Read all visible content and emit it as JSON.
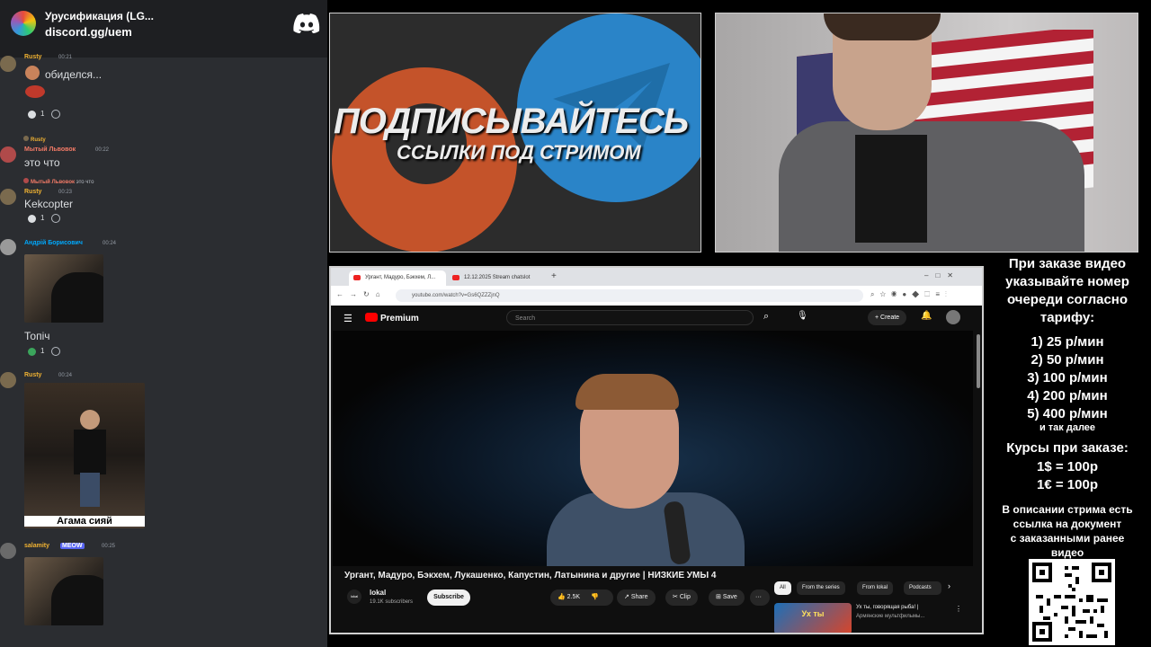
{
  "discord": {
    "server_title": "Урусификация (LG...",
    "invite": "discord.gg/uem",
    "messages": [
      {
        "author": "Rusty",
        "author_color": "#f0b232",
        "timestamp": "00:21",
        "text": "обиделся...",
        "reaction_count": "1"
      },
      {
        "reply_author": "Rusty",
        "author": "Мытый Львовок",
        "author_color": "#f47b67",
        "timestamp": "00:22",
        "text": "это что"
      },
      {
        "reply_author": "Мытый Львовок",
        "reply_text": "это что",
        "author": "Rusty",
        "author_color": "#f0b232",
        "timestamp": "00:23",
        "text": "Kekcopter",
        "reaction_count": "1"
      },
      {
        "author": "Андрій Борисович",
        "author_color": "#00a8fc",
        "timestamp": "00:24",
        "text": "Топіч",
        "reaction_count": "1"
      },
      {
        "author": "Rusty",
        "author_color": "#f0b232",
        "timestamp": "00:24",
        "gif_caption": "Агама сияй"
      },
      {
        "author": "salamity",
        "author_color": "#f0b232",
        "badge": "MEOW",
        "timestamp": "00:25"
      }
    ]
  },
  "banner": {
    "title": "ПОДПИСЫВАЙТЕСЬ",
    "subtitle": "ССЫЛКИ ПОД СТРИМОМ"
  },
  "browser": {
    "tabs": [
      {
        "label": "Ургант, Мадуро, Бэкхем, Л...",
        "active": true
      },
      {
        "label": "12.12.2025 Stream chatslot",
        "active": false
      }
    ],
    "url": "youtube.com/watch?v=Gs6QZZZjnQ"
  },
  "youtube": {
    "logo": "Premium",
    "search_placeholder": "Search",
    "create_label": "Create",
    "video_title": "Ургант, Мадуро, Бэкхем, Лукашенко, Капустин, Латынина и другие | НИЗКИЕ УМЫ 4",
    "channel": {
      "name": "lokal",
      "subscribers": "19.1K subscribers",
      "avatar_text": "lokal"
    },
    "subscribe_label": "Subscribe",
    "likes": "2.5K",
    "share_label": "Share",
    "clip_label": "Clip",
    "save_label": "Save",
    "chips": [
      "All",
      "From the series",
      "From lokal",
      "Podcasts"
    ],
    "recommendation": {
      "thumb_text": "Ух ты",
      "title": "Ух ты, говорящая рыба! |",
      "subtitle": "Армянские мультфильмы..."
    }
  },
  "order_info": {
    "heading_lines": [
      "При заказе видео",
      "указывайте номер",
      "очереди согласно",
      "тарифу:"
    ],
    "tariffs": [
      "1) 25 р/мин",
      "2) 50 р/мин",
      "3) 100 р/мин",
      "4) 200 р/мин",
      "5) 400 р/мин"
    ],
    "tariffs_more": "и так далее",
    "rates_heading": "Курсы при заказе:",
    "rates": [
      "1$ = 100р",
      "1€ = 100р"
    ],
    "doc_lines": [
      "В описании стрима есть",
      "ссылка на документ",
      "с заказанными ранее",
      "видео"
    ]
  },
  "colors": {
    "discord_bg": "#2b2d31",
    "youtube_red": "#ff0000",
    "telegram_blue": "#2a84c8",
    "boosty_orange": "#c4532a"
  }
}
